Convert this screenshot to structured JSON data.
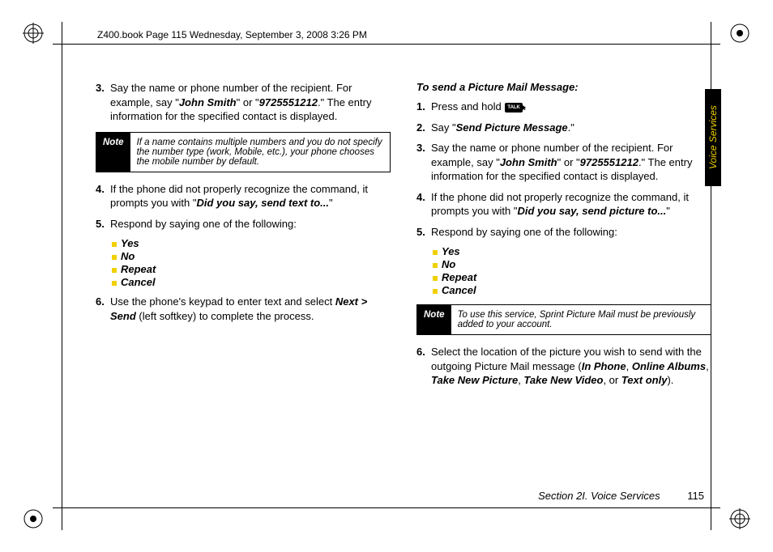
{
  "header": "Z400.book  Page 115  Wednesday, September 3, 2008  3:26 PM",
  "side_tab": "Voice Services",
  "footer": {
    "section": "Section 2I. Voice Services",
    "page": "115"
  },
  "left": {
    "step3": {
      "n": "3.",
      "t1": "Say the name or phone number of the recipient. For example, say \"",
      "john": "John Smith",
      "t2": "\" or \"",
      "numb": "9725551212",
      "t3": ".\" The entry information for the specified contact is displayed."
    },
    "note": {
      "label": "Note",
      "text": "If a name contains multiple numbers and you do not specify the number type (work, Mobile, etc.), your phone chooses the mobile number by default."
    },
    "step4": {
      "n": "4.",
      "t1": "If the phone did not properly recognize the command, it prompts you with \"",
      "q": "Did you say, send text to...",
      "t2": "\""
    },
    "step5": {
      "n": "5.",
      "t": "Respond by saying one of the following:"
    },
    "opts": [
      "Yes",
      "No",
      "Repeat",
      "Cancel"
    ],
    "step6": {
      "n": "6.",
      "t1": "Use the phone's keypad to enter text and select ",
      "next": "Next > Send",
      "t2": " (left softkey) to complete the process."
    }
  },
  "right": {
    "head": "To send a Picture Mail Message:",
    "step1": {
      "n": "1.",
      "t1": "Press and hold ",
      "talk": "TALK",
      "t2": "."
    },
    "step2": {
      "n": "2.",
      "t1": "Say \"",
      "cmd": "Send Picture Message",
      "t2": ".\""
    },
    "step3": {
      "n": "3.",
      "t1": "Say the name or phone number of the recipient. For example, say \"",
      "john": "John Smith",
      "t2": "\" or \"",
      "numb": "9725551212",
      "t3": ".\" The entry information for the specified contact is displayed."
    },
    "step4": {
      "n": "4.",
      "t1": "If the phone did not properly recognize the command, it prompts you with \"",
      "q": "Did you say, send picture to...",
      "t2": "\""
    },
    "step5": {
      "n": "5.",
      "t": "Respond by saying one of the following:"
    },
    "opts": [
      "Yes",
      "No",
      "Repeat",
      "Cancel"
    ],
    "note": {
      "label": "Note",
      "text": "To use this service, Sprint Picture Mail must be previously added to your account."
    },
    "step6": {
      "n": "6.",
      "t1": "Select the location of the picture you wish to send with the outgoing Picture Mail message (",
      "o1": "In Phone",
      "c1": ", ",
      "o2": "Online Albums",
      "c2": ", ",
      "o3": "Take New Picture",
      "c3": ", ",
      "o4": "Take New Video",
      "c4": ", or ",
      "o5": "Text only",
      "t2": ")."
    }
  }
}
